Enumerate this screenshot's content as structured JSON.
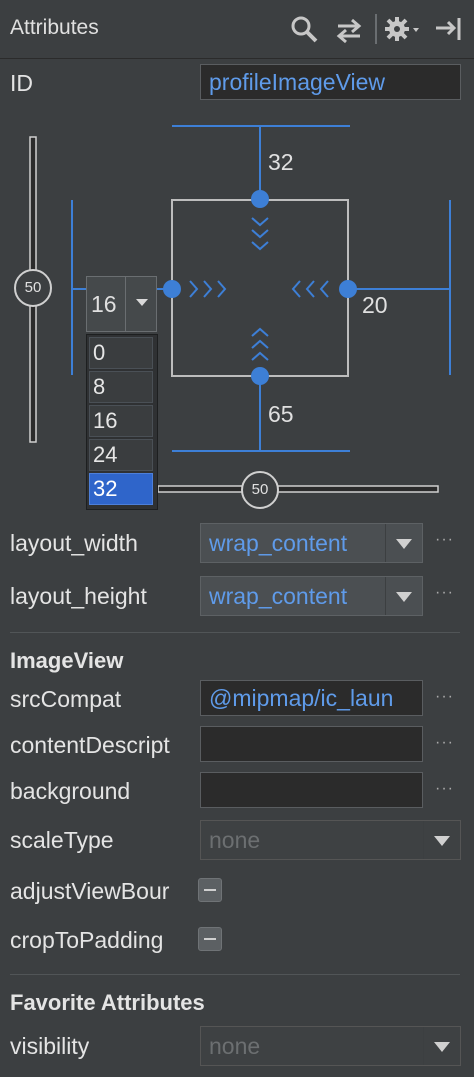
{
  "header": {
    "title": "Attributes",
    "icons": [
      "search-icon",
      "swap-icon",
      "gear-icon",
      "pin-icon"
    ]
  },
  "id_row": {
    "label": "ID",
    "value": "profileImageView"
  },
  "constraints": {
    "margin_top": "32",
    "margin_right": "20",
    "margin_bottom": "65",
    "vertical_bias": "50",
    "horizontal_bias": "50",
    "left_margin_selected": "16",
    "dropdown_options": [
      "0",
      "8",
      "16",
      "24",
      "32"
    ],
    "dropdown_highlighted": "32"
  },
  "layout": {
    "width_label": "layout_width",
    "width_value": "wrap_content",
    "height_label": "layout_height",
    "height_value": "wrap_content"
  },
  "imageview": {
    "section_title": "ImageView",
    "src_label": "srcCompat",
    "src_value": "@mipmap/ic_laun",
    "content_label": "contentDescript",
    "background_label": "background",
    "scale_label": "scaleType",
    "scale_value": "none",
    "adjust_label": "adjustViewBour",
    "crop_label": "cropToPadding"
  },
  "favorites": {
    "section_title": "Favorite Attributes",
    "visibility_label": "visibility",
    "visibility_value": "none"
  },
  "colors": {
    "background": "#3c3f41",
    "accent": "#5f9bea",
    "constraint_blue": "#3d7fd6",
    "selected": "#2f65ca"
  }
}
